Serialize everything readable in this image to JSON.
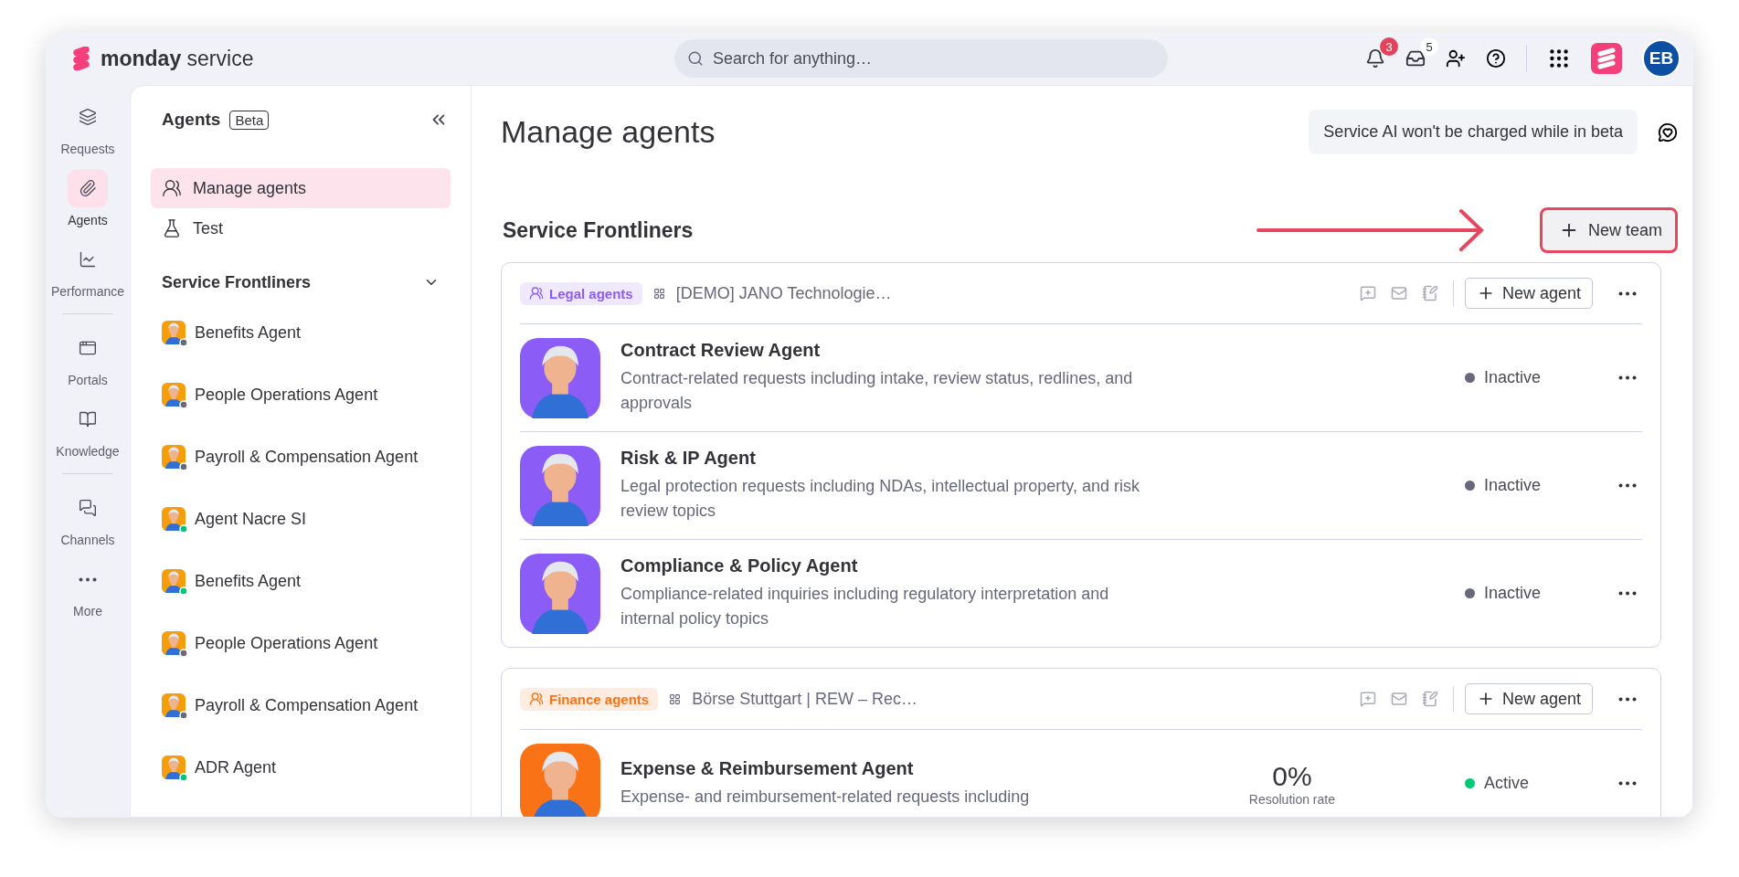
{
  "topbar": {
    "brand_bold": "monday",
    "brand_rest": "service",
    "search": {
      "placeholder": "Search for anything…"
    },
    "notifications_badge": "3",
    "inbox_badge": "5",
    "avatar_initials": "EB"
  },
  "rail": [
    {
      "label": "Requests",
      "selected": false,
      "kind": "requests"
    },
    {
      "label": "Agents",
      "selected": true,
      "kind": "agents"
    },
    {
      "label": "Performance",
      "selected": false,
      "kind": "performance"
    },
    {
      "label": "Portals",
      "selected": false,
      "kind": "portals"
    },
    {
      "label": "Knowledge",
      "selected": false,
      "kind": "knowledge"
    },
    {
      "label": "Channels",
      "selected": false,
      "kind": "channels"
    },
    {
      "label": "More",
      "selected": false,
      "kind": "more"
    }
  ],
  "sidebar": {
    "title": "Agents",
    "badge": "Beta",
    "items": [
      {
        "label": "Manage agents",
        "selected": true,
        "kind": "manage"
      },
      {
        "label": "Test",
        "selected": false,
        "kind": "test"
      }
    ],
    "section": {
      "title": "Service Frontliners",
      "expanded": true,
      "agents": [
        {
          "name": "Benefits Agent",
          "active": false
        },
        {
          "name": "People Operations Agent",
          "active": false
        },
        {
          "name": "Payroll & Compensation Agent",
          "active": false
        },
        {
          "name": "Agent Nacre SI",
          "active": true
        },
        {
          "name": "Benefits Agent",
          "active": true
        },
        {
          "name": "People Operations Agent",
          "active": false
        },
        {
          "name": "Payroll & Compensation Agent",
          "active": false
        },
        {
          "name": "ADR Agent",
          "active": true
        }
      ]
    }
  },
  "main": {
    "title": "Manage agents",
    "notice": "Service AI won't be charged while in beta",
    "section_title": "Service Frontliners",
    "new_team_button": "New team",
    "teams": [
      {
        "tag": "Legal agents",
        "color": "#8b5cf6",
        "workspace": "[DEMO] JANO Technologie…",
        "new_agent_button": "New agent",
        "agents": [
          {
            "name": "Contract Review Agent",
            "description": "Contract-related requests including intake, review status, redlines, and approvals",
            "status": "Inactive",
            "active": false
          },
          {
            "name": "Risk & IP Agent",
            "description": "Legal protection requests including NDAs, intellectual property, and risk review topics",
            "status": "Inactive",
            "active": false
          },
          {
            "name": "Compliance & Policy Agent",
            "description": "Compliance-related inquiries including regulatory interpretation and internal policy topics",
            "status": "Inactive",
            "active": false
          }
        ]
      },
      {
        "tag": "Finance agents",
        "color": "#f97316",
        "workspace": "Börse Stuttgart | REW – Rec…",
        "new_agent_button": "New agent",
        "agents": [
          {
            "name": "Expense & Reimbursement Agent",
            "description": "Expense- and reimbursement-related requests including",
            "status": "Active",
            "active": true,
            "stat": {
              "value": "0%",
              "label": "Resolution rate"
            }
          }
        ]
      }
    ]
  }
}
